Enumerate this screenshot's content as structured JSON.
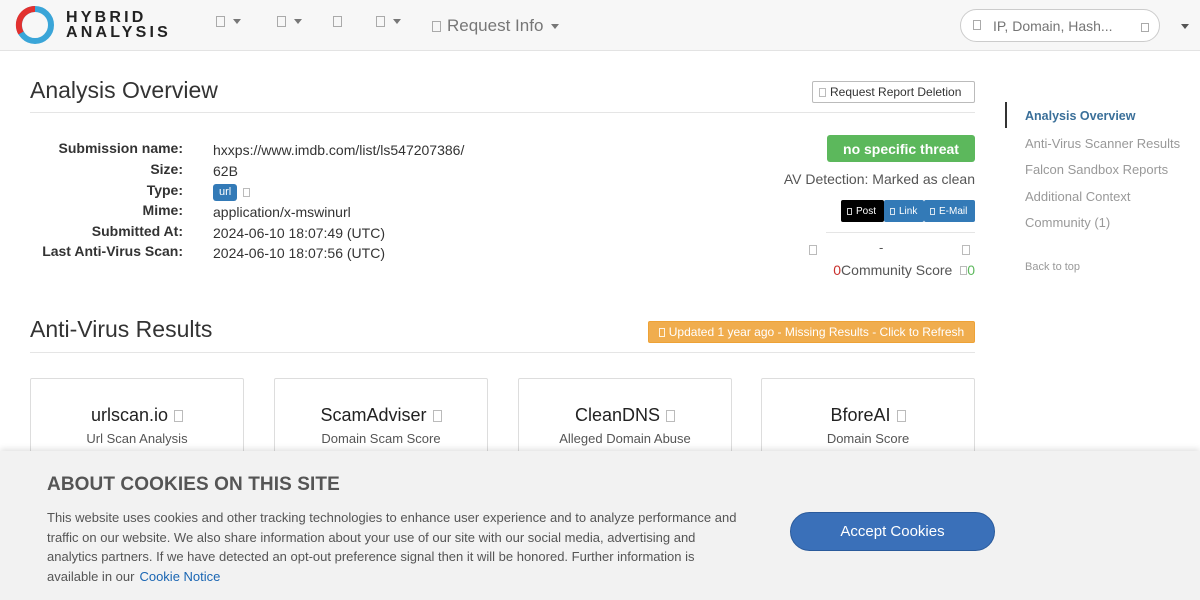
{
  "logo": {
    "line1": "HYBRID",
    "line2": "ANALYSIS"
  },
  "nav": {
    "items": [
      {
        "icon": "upload-icon",
        "label": ""
      },
      {
        "icon": "document-icon",
        "label": ""
      },
      {
        "icon": "globe-icon",
        "label": ""
      },
      {
        "icon": "file-icon",
        "label": ""
      },
      {
        "icon": "info-icon",
        "label": "Request Info"
      }
    ],
    "search_placeholder": "IP, Domain, Hash..."
  },
  "overview": {
    "title": "Analysis Overview",
    "deletion_button": "Request Report Deletion",
    "fields": [
      {
        "label": "Submission name:",
        "value": "hxxps://www.imdb.com/list/ls547207386/"
      },
      {
        "label": "Size:",
        "value": "62B"
      },
      {
        "label": "Type:",
        "value": "url"
      },
      {
        "label": "Mime:",
        "value": "application/x-mswinurl"
      },
      {
        "label": "Submitted At:",
        "value": "2024-06-10 18:07:49 (UTC)"
      },
      {
        "label": "Last Anti-Virus Scan:",
        "value": "2024-06-10 18:07:56 (UTC)"
      }
    ],
    "threat_label": "no specific threat",
    "av_detection": "AV Detection: Marked as clean",
    "share": {
      "post": "Post",
      "link": "Link",
      "email": "E-Mail"
    },
    "vote_dash": "-",
    "community": {
      "down": "0",
      "label": "Community Score",
      "up": "0"
    }
  },
  "av_results": {
    "title": "Anti-Virus Results",
    "refresh_button": "Updated 1 year ago - Missing Results - Click to Refresh",
    "cards": [
      {
        "name": "urlscan.io",
        "desc": "Url Scan Analysis"
      },
      {
        "name": "ScamAdviser",
        "desc": "Domain Scam Score"
      },
      {
        "name": "CleanDNS",
        "desc": "Alleged Domain Abuse"
      },
      {
        "name": "BforeAI",
        "desc": "Domain Score"
      }
    ]
  },
  "sidebar": {
    "items": [
      {
        "label": "Analysis Overview",
        "active": true
      },
      {
        "label": "Anti-Virus Scanner Results"
      },
      {
        "label": "Falcon Sandbox Reports"
      },
      {
        "label": "Additional Context"
      },
      {
        "label": "Community (1)"
      }
    ],
    "back_to_top": "Back to top"
  },
  "cookie": {
    "title": "ABOUT COOKIES ON THIS SITE",
    "text": "This website uses cookies and other tracking technologies to enhance user experience and to analyze performance and traffic on our website. We also share information about your use of our site with our social media, advertising and analytics partners. If we have detected an opt-out preference signal then it will be honored. Further information is available in our",
    "link": "Cookie Notice",
    "accept": "Accept Cookies"
  },
  "colors": {
    "brand_red": "#e2312f",
    "brand_blue": "#3aa5d8",
    "clean_green": "#5cb85c",
    "refresh_orange": "#f0ad4e",
    "accept_blue": "#3a70b9",
    "url_badge": "#337ab7"
  }
}
